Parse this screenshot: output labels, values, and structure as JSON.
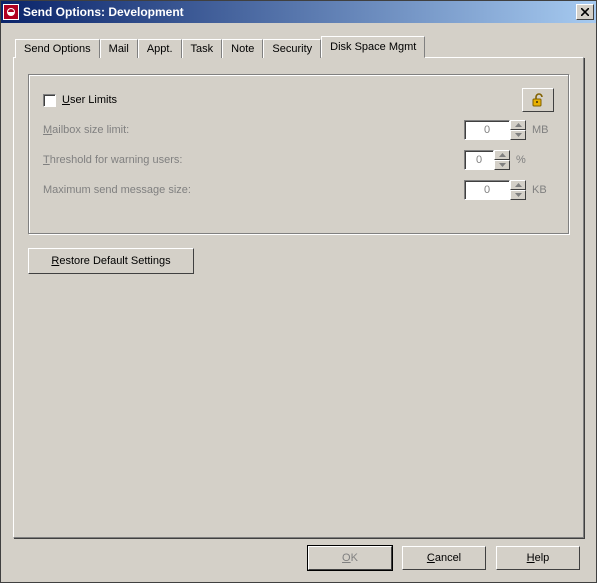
{
  "window": {
    "title": "Send Options:  Development"
  },
  "tabs": [
    {
      "label": "Send Options"
    },
    {
      "label": "Mail"
    },
    {
      "label": "Appt."
    },
    {
      "label": "Task"
    },
    {
      "label": "Note"
    },
    {
      "label": "Security"
    },
    {
      "label": "Disk Space Mgmt"
    }
  ],
  "group": {
    "user_limits_prefix": "U",
    "user_limits_rest": "ser Limits",
    "mailbox_prefix": "M",
    "mailbox_rest": "ailbox size limit:",
    "mailbox_value": "0",
    "mailbox_unit": "MB",
    "threshold_prefix": "T",
    "threshold_rest": "hreshold for warning users:",
    "threshold_value": "0",
    "threshold_unit": "%",
    "maxsend_prefix": "M",
    "maxsend_rest": "aximum send message size:",
    "maxsend_value": "0",
    "maxsend_unit": "KB"
  },
  "restore_prefix": "R",
  "restore_rest": "estore Default Settings",
  "buttons": {
    "ok_prefix": "O",
    "ok_rest": "K",
    "cancel_prefix": "C",
    "cancel_rest": "ancel",
    "help_prefix": "H",
    "help_rest": "elp"
  }
}
